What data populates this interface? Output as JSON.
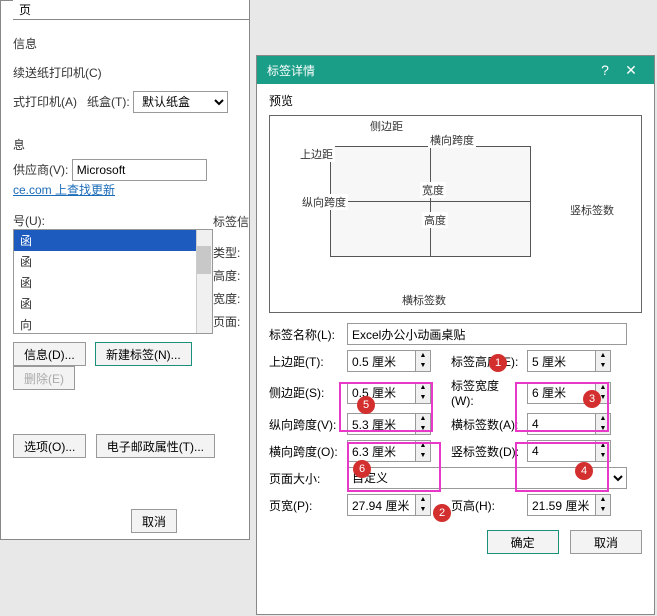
{
  "win1": {
    "header_tab": "页",
    "section_info": "信息",
    "feeder": "续送纸打印机(C)",
    "manual": "式打印机(A)",
    "tray_lbl": "纸盒(T):",
    "tray_value": "默认纸盒",
    "info_section": "息",
    "vendor_lbl": "供应商(V):",
    "vendor_value": "Microsoft",
    "update_link": "ce.com 上查找更新",
    "product_lbl": "号(U):",
    "list_items": [
      "函",
      "函",
      "函",
      "函",
      "向"
    ],
    "label_section": "标签信",
    "type_lbl": "类型:",
    "height_lbl": "高度:",
    "width_lbl": "宽度:",
    "page_lbl": "页面:",
    "btn_info": "信息(D)...",
    "btn_new": "新建标签(N)...",
    "btn_delete": "删除(E)",
    "btn_options": "选项(O)...",
    "btn_mail": "电子邮政属性(T)...",
    "btn_cancel": "取消"
  },
  "win2": {
    "title": "标签详情",
    "preview_lbl": "预览",
    "diagram": {
      "side_margin": "侧边距",
      "top_margin": "上边距",
      "h_span": "横向跨度",
      "v_span": "纵向跨度",
      "width": "宽度",
      "height": "高度",
      "h_count": "横标签数",
      "v_count": "竖标签数"
    },
    "name_lbl": "标签名称(L):",
    "name_value": "Excel办公小动画桌贴",
    "top_lbl": "上边距(T):",
    "top_value": "0.5 厘米",
    "side_lbl": "侧边距(S):",
    "side_value": "0.5 厘米",
    "lheight_lbl": "标签高度(E):",
    "lheight_value": "5 厘米",
    "lwidth_lbl": "标签宽度(W):",
    "lwidth_value": "6 厘米",
    "vspan_lbl": "纵向跨度(V):",
    "vspan_value": "5.3 厘米",
    "hspan_lbl": "横向跨度(O):",
    "hspan_value": "6.3 厘米",
    "hcount_lbl": "横标签数(A):",
    "hcount_value": "4",
    "vcount_lbl": "竖标签数(D):",
    "vcount_value": "4",
    "pagesize_lbl": "页面大小:",
    "pagesize_value": "自定义",
    "pagew_lbl": "页宽(P):",
    "pagew_value": "27.94 厘米",
    "pageh_lbl": "页高(H):",
    "pageh_value": "21.59 厘米",
    "btn_ok": "确定",
    "btn_cancel": "取消"
  }
}
